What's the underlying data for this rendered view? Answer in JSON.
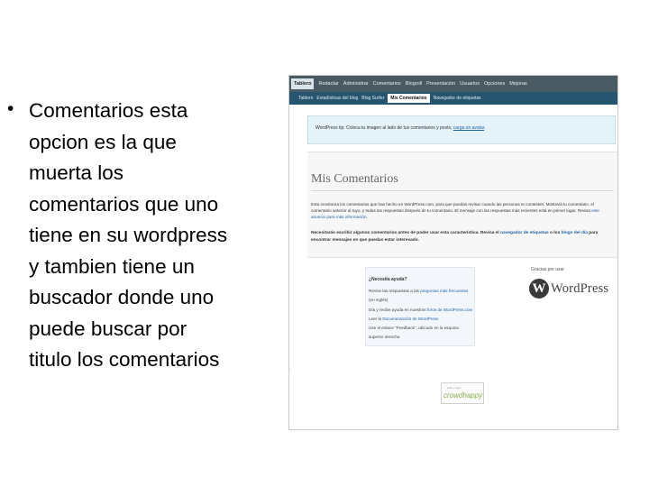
{
  "slide": {
    "bullet_symbol": "•",
    "bullet_text": "Comentarios esta\nopcion es la que\nmuerta los\ncomentarios que uno\ntiene en su wordpress\ny tambien tiene un\nbuscador donde uno\npuede buscar por\ntitulo los comentarios"
  },
  "screenshot": {
    "top_nav": [
      "Tablero",
      "Redactar",
      "Administrar",
      "Comentarios",
      "Blogroll",
      "Presentación",
      "Usuarios",
      "Opciones",
      "Mejoras"
    ],
    "top_nav_active": "Tablero",
    "sub_nav": [
      "Tablero",
      "Estadísticas del blog",
      "Blog Surfer",
      "Mis Comentarios",
      "Navegador de etiquetas"
    ],
    "sub_nav_active": "Mis Comentarios",
    "tip_prefix": "WordPress tip: Coloca tu imagen al lado de tus comentarios y posts,",
    "tip_link": "carga un avatar",
    "tip_suffix": ".",
    "panel_title": "Mis Comentarios",
    "panel_text_1": "Esta monitorea los comentarios que has hecho en WordPress.com, para que puedas revisar cuando las personas te contesten. Mostrará tu comentario, el comentario anterior al tuyo, y todas las respuestas después de tu comentario. El mensaje con las respuestas más recientes está en primer lugar. Revisa",
    "panel_text_link": "este anuncio para más información",
    "panel_text_2": ".",
    "panel_note_1": "Necesitarás escribir algunos comentarios antes de poder usar esta característica. Revisa el",
    "panel_note_link_1": "navegador de etiquetas",
    "panel_note_2": "o los",
    "panel_note_link_2": "blogs del día",
    "panel_note_3": "para encontrar mensajes en que puedas estar interesado.",
    "help_title": "¿Necesita ayuda?",
    "help_line_1a": "Revise las respuestas a las",
    "help_line_1_link": "preguntas más frecuentes",
    "help_line_1b": "(en inglés)",
    "help_line_2a": "Día y recibe ayuda en nuestros",
    "help_line_2_link": "foros de WordPress.com",
    "help_line_3a": "Leer la",
    "help_line_3_link": "Documentación de WordPress",
    "help_line_4": "Use el enlace \"Feedback\", ubicado en la esquina superior derecha",
    "credit_text": "Gracias por usar",
    "logo_letter": "W",
    "logo_text": "WordPress",
    "badge_top": "sello y logo",
    "badge_text": "crowdhappy"
  }
}
